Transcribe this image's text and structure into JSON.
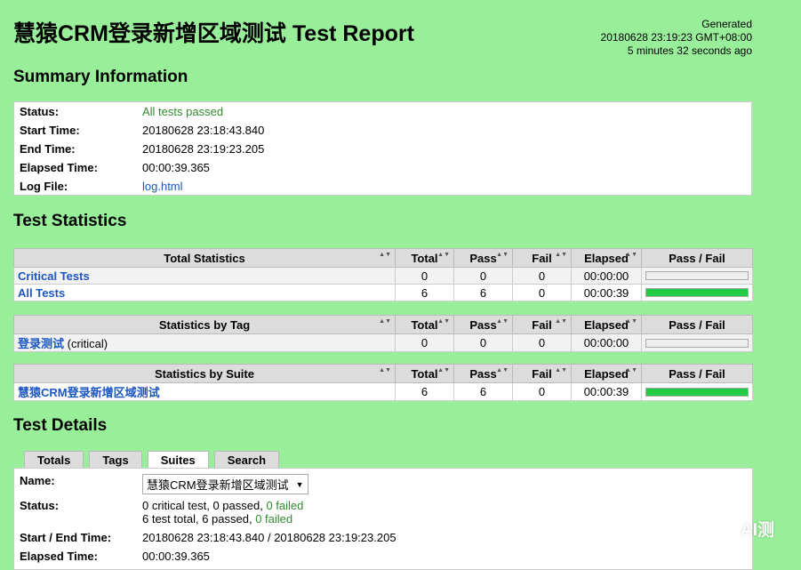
{
  "header": {
    "title": "慧猿CRM登录新增区域测试 Test Report",
    "generated_label": "Generated",
    "generated_time": "20180628 23:19:23 GMT+08:00",
    "generated_ago": "5 minutes 32 seconds ago"
  },
  "summary": {
    "heading": "Summary Information",
    "rows": [
      {
        "key": "Status:",
        "value": "All tests passed"
      },
      {
        "key": "Start Time:",
        "value": "20180628 23:18:43.840"
      },
      {
        "key": "End Time:",
        "value": "20180628 23:19:23.205"
      },
      {
        "key": "Elapsed Time:",
        "value": "00:00:39.365"
      },
      {
        "key": "Log File:",
        "value": "log.html"
      }
    ]
  },
  "statistics": {
    "heading": "Test Statistics",
    "columns": [
      "Total",
      "Pass",
      "Fail",
      "Elapsed",
      "Pass / Fail"
    ],
    "total": {
      "header": "Total Statistics",
      "rows": [
        {
          "name": "Critical Tests",
          "total": "0",
          "pass": "0",
          "fail": "0",
          "elapsed": "00:00:00",
          "pass_ratio": 0
        },
        {
          "name": "All Tests",
          "total": "6",
          "pass": "6",
          "fail": "0",
          "elapsed": "00:00:39",
          "pass_ratio": 1
        }
      ]
    },
    "by_tag": {
      "header": "Statistics by Tag",
      "rows": [
        {
          "name": "登录测试",
          "suffix": "(critical)",
          "total": "0",
          "pass": "0",
          "fail": "0",
          "elapsed": "00:00:00",
          "pass_ratio": 0
        }
      ]
    },
    "by_suite": {
      "header": "Statistics by Suite",
      "rows": [
        {
          "name": "慧猿CRM登录新增区域测试",
          "total": "6",
          "pass": "6",
          "fail": "0",
          "elapsed": "00:00:39",
          "pass_ratio": 1
        }
      ]
    }
  },
  "details": {
    "heading": "Test Details",
    "tabs": [
      "Totals",
      "Tags",
      "Suites",
      "Search"
    ],
    "active_tab": "Suites",
    "name_label": "Name:",
    "name_value": "慧猿CRM登录新增区域测试",
    "status_label": "Status:",
    "status_line1_a": "0 critical test, 0 passed, ",
    "status_line1_b": "0 failed",
    "status_line2_a": "6 test total, 6 passed, ",
    "status_line2_b": "0 failed",
    "start_end_label": "Start / End Time:",
    "start_end_value": "20180628 23:18:43.840 / 20180628 23:19:23.205",
    "elapsed_label": "Elapsed Time:",
    "elapsed_value": "00:00:39.365"
  },
  "watermark": {
    "text": "AI测",
    "icon": "wechat-icon"
  },
  "colors": {
    "background": "#99ee99",
    "pass": "#22cc44",
    "link": "#1a56c4"
  }
}
